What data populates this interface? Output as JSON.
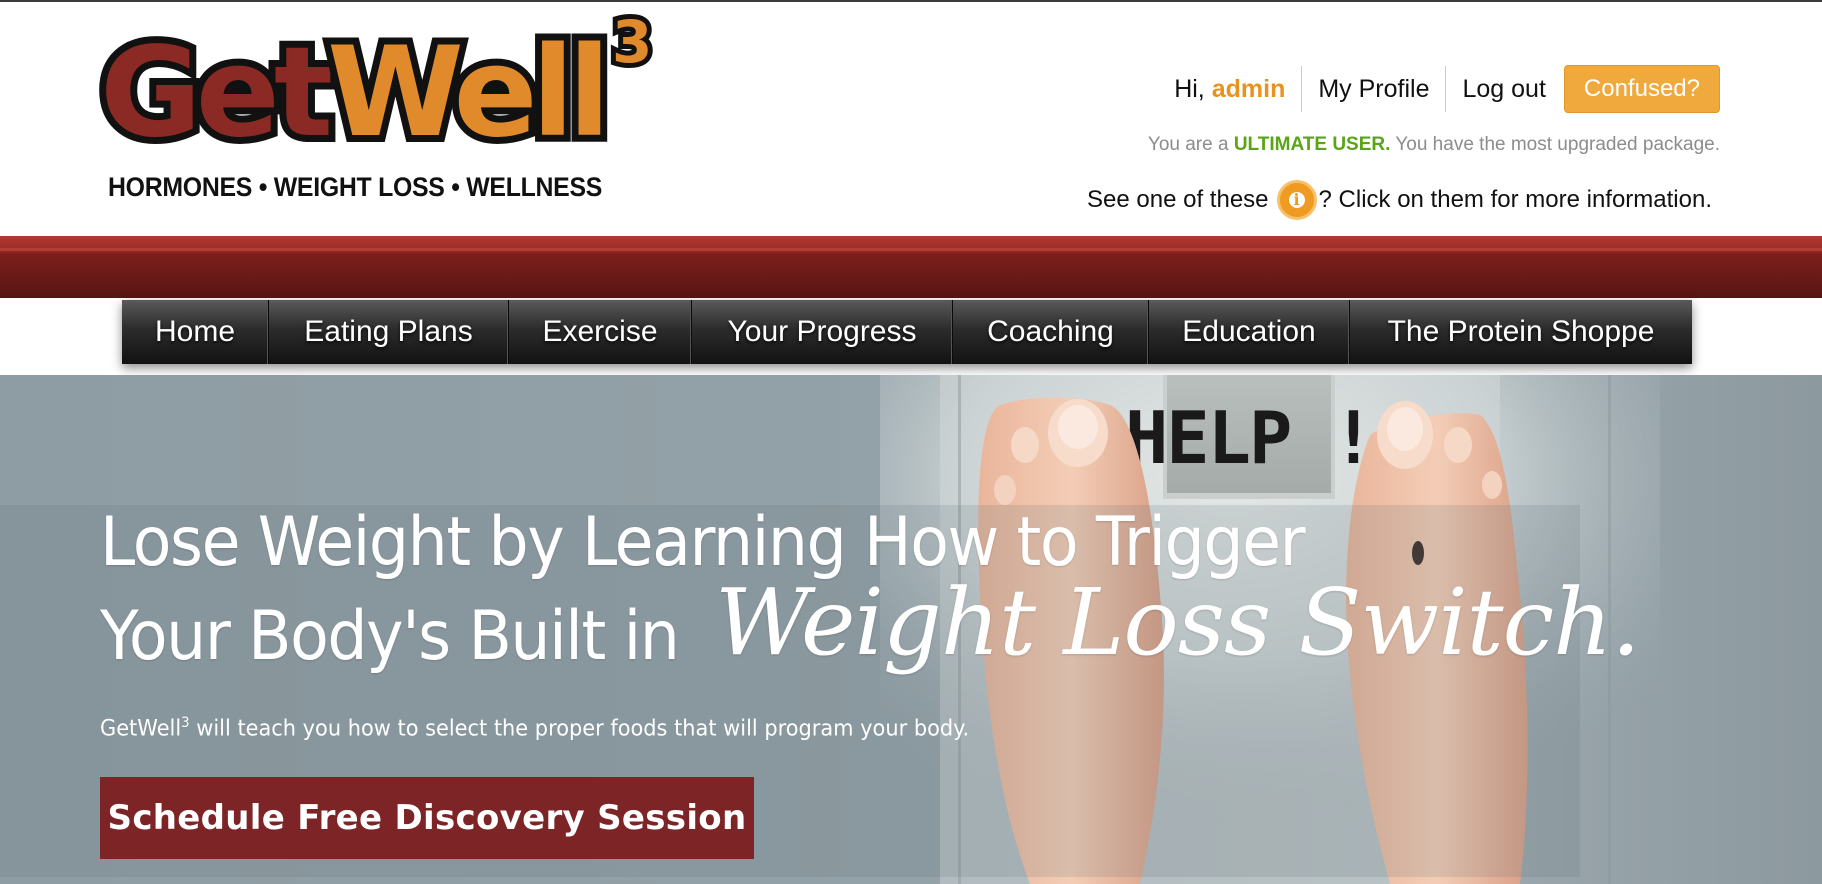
{
  "logo": {
    "word_get": "Get",
    "word_well": "Well",
    "superscript": "3",
    "tagline": "HORMONES • WEIGHT LOSS • WELLNESS"
  },
  "user_bar": {
    "greeting": "Hi,",
    "username": "admin",
    "my_profile": "My Profile",
    "log_out": "Log out",
    "confused": "Confused?"
  },
  "membership": {
    "prefix": "You are a",
    "level": "ULTIMATE USER.",
    "suffix": "You have the most upgraded package."
  },
  "info_hint": {
    "before": "See one of these",
    "icon_glyph": "i",
    "after": "? Click on them for more information."
  },
  "nav": {
    "items": [
      "Home",
      "Eating Plans",
      "Exercise",
      "Your Progress",
      "Coaching",
      "Education",
      "The Protein Shoppe"
    ]
  },
  "hero": {
    "title_line1": "Lose Weight by Learning How to Trigger",
    "title_line2_plain": "Your Body's Built in",
    "title_line2_script": "Weight Loss Switch.",
    "scale_display": "HELP !",
    "sub_brand": "GetWell",
    "sub_sup": "3",
    "sub_text": " will teach you how to select the proper foods that will program your body.",
    "cta": "Schedule Free Discovery Session"
  },
  "colors": {
    "brand_red": "#8b2a25",
    "brand_orange": "#e08a2c",
    "accent_green": "#5aa418",
    "cta_red": "#7d2426"
  }
}
